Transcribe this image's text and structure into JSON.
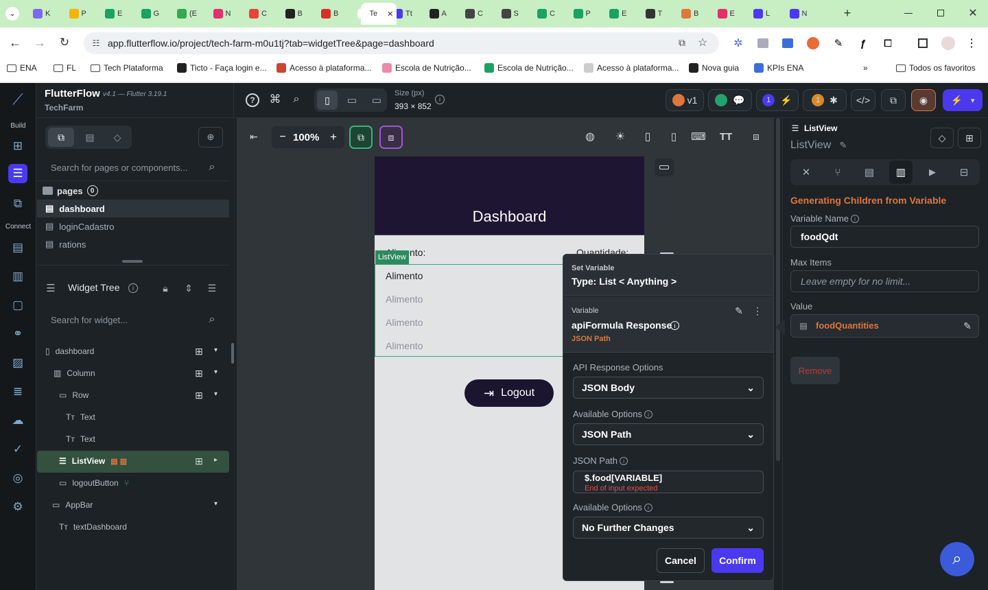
{
  "browser": {
    "tabs": [
      "K",
      "P",
      "E",
      "G",
      "(E",
      "N",
      "C",
      "B",
      "B",
      "Te",
      "Tt",
      "A",
      "C",
      "S",
      "C",
      "P",
      "E",
      "T",
      "B",
      "E",
      "L",
      "N"
    ],
    "url": "app.flutterflow.io/project/tech-farm-m0u1tj?tab=widgetTree&page=dashboard",
    "bookmarks": [
      "ENA",
      "FL",
      "Tech Plataforma",
      "Ticto - Faça login e...",
      "Acesso à plataforma...",
      "Escola de Nutrição...",
      "Escola de Nutrição...",
      "Acesso à plataforma...",
      "Nova guia",
      "KPIs ENA"
    ],
    "all_bookmarks": "Todos os favoritos"
  },
  "app": {
    "name": "FlutterFlow",
    "version": "v4.1 — Flutter 3.19.1",
    "project": "TechFarm",
    "size_label": "Size (px)",
    "size_value": "393 × 852",
    "version_badge": "v1",
    "badge_count": "1",
    "warn_count": "1"
  },
  "rail": {
    "build_label": "Build",
    "connect_label": "Connect"
  },
  "left_panel": {
    "search_placeholder": "Search for pages or components...",
    "pages_label": "pages",
    "pages_count": "0",
    "pages": [
      "dashboard",
      "loginCadastro",
      "rations"
    ],
    "widget_tree_title": "Widget Tree",
    "widget_search_placeholder": "Search for widget...",
    "tree": [
      "dashboard",
      "Column",
      "Row",
      "Text",
      "Text",
      "ListView",
      "logoutButton",
      "AppBar",
      "textDashboard"
    ]
  },
  "canvas": {
    "zoom": "100%",
    "page_title": "Dashboard",
    "col_left": "Alimento:",
    "col_right": "Quantidade:",
    "listview_tag": "ListView",
    "items": [
      "Alimento",
      "Alimento",
      "Alimento",
      "Alimento"
    ],
    "logout_label": "Logout"
  },
  "popup": {
    "set_variable": "Set Variable",
    "type_label": "Type: List < Anything >",
    "variable_label": "Variable",
    "variable_name": "apiFormula Response",
    "json_path_tag": "JSON Path",
    "api_opts_label": "API Response Options",
    "api_opts_value": "JSON Body",
    "avail_opts_label": "Available Options",
    "avail_opts_value": "JSON Path",
    "json_path_label": "JSON Path",
    "json_path_value": "$.food[VARIABLE]",
    "json_path_error": "End of input expected",
    "avail_opts2_label": "Available Options",
    "avail_opts2_value": "No Further Changes",
    "cancel": "Cancel",
    "confirm": "Confirm"
  },
  "right_panel": {
    "widget_type": "ListView",
    "widget_name": "ListView",
    "section_title": "Generating Children from Variable",
    "var_name_label": "Variable Name",
    "var_name_value": "foodQdt",
    "max_items_label": "Max Items",
    "max_items_placeholder": "Leave empty for no limit...",
    "value_label": "Value",
    "value_value": "foodQuantities",
    "remove": "Remove"
  },
  "colors": {
    "accent": "#4b39ef",
    "orange": "#e0763a",
    "error": "#e64b4b"
  }
}
